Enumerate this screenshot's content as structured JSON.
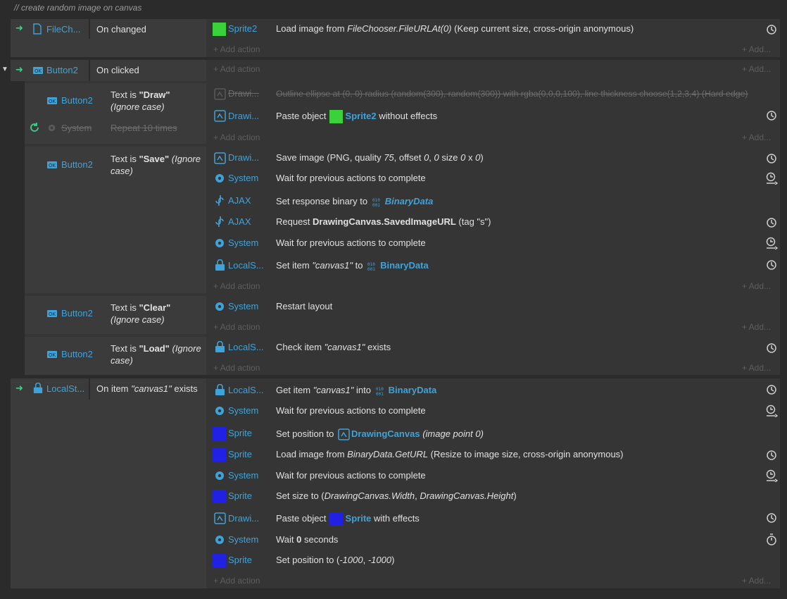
{
  "comment": "//  create random image on canvas",
  "add_action": "+ Add action",
  "add_more": "+ Add...",
  "events": [
    {
      "cond": {
        "obj": "FileCh...",
        "text": "On changed"
      },
      "actions": [
        {
          "obj": "Sprite2",
          "text": "Load image from FileChooser.FileURLAt(0) (Keep current size, cross-origin anonymous)"
        }
      ]
    },
    {
      "cond": {
        "obj": "Button2",
        "text": "On clicked"
      }
    },
    {
      "sub1": {
        "obj": "Button2",
        "text_pre": "Text is ",
        "text_val": "\"Draw\"",
        "text_post": "(Ignore case)",
        "sys": "System",
        "repeat": "Repeat 10 times",
        "actions": [
          {
            "obj": "Drawi...",
            "text": "Outline ellipse at (0, 0) radius (random(300), random(300)) with rgba(0,0,0,100), line thickness choose(1,2,3,4) (Hard edge)"
          },
          {
            "obj": "Drawi...",
            "pre": "Paste object",
            "target": "Sprite2",
            "post": "without effects"
          }
        ]
      }
    },
    {
      "sub2": {
        "obj": "Button2",
        "text_pre": "Text is ",
        "text_val": "\"Save\"",
        "text_post": "(Ignore case)",
        "actions": [
          {
            "obj": "Drawi...",
            "text": "Save image (PNG, quality 75, offset 0, 0 size 0 x 0)"
          },
          {
            "obj": "System",
            "text": "Wait for previous actions to complete"
          },
          {
            "obj": "AJAX",
            "pre": "Set response binary to",
            "target": "BinaryData"
          },
          {
            "obj": "AJAX",
            "pre": "Request",
            "bold": "DrawingCanvas.SavedImageURL",
            "post": "(tag \"s\")"
          },
          {
            "obj": "System",
            "text": "Wait for previous actions to complete"
          },
          {
            "obj": "LocalS...",
            "pre": "Set item",
            "item": "\"canvas1\"",
            "mid": "to",
            "target": "BinaryData"
          }
        ]
      }
    },
    {
      "sub3": {
        "obj": "Button2",
        "text_pre": "Text is ",
        "text_val": "\"Clear\"",
        "text_post": "(Ignore case)",
        "actions": [
          {
            "obj": "System",
            "text": "Restart layout"
          }
        ]
      }
    },
    {
      "sub4": {
        "obj": "Button2",
        "text_pre": "Text is ",
        "text_val": "\"Load\"",
        "text_post": "(Ignore case)",
        "actions": [
          {
            "obj": "LocalS...",
            "pre": "Check item",
            "item": "\"canvas1\"",
            "post": "exists"
          }
        ]
      }
    },
    {
      "ev3": {
        "obj": "LocalSt...",
        "text_pre": "On item ",
        "item": "\"canvas1\"",
        "text_post": " exists",
        "actions": [
          {
            "obj": "LocalS...",
            "pre": "Get item",
            "item": "\"canvas1\"",
            "mid": "into",
            "target": "BinaryData"
          },
          {
            "obj": "System",
            "text": "Wait for previous actions to complete"
          },
          {
            "obj": "Sprite",
            "pre": "Set position to",
            "target": "DrawingCanvas",
            "post": "(image point 0)"
          },
          {
            "obj": "Sprite",
            "text": "Load image from BinaryData.GetURL (Resize to image size, cross-origin anonymous)"
          },
          {
            "obj": "System",
            "text": "Wait for previous actions to complete"
          },
          {
            "obj": "Sprite",
            "text": "Set size to (DrawingCanvas.Width, DrawingCanvas.Height)"
          },
          {
            "obj": "Drawi...",
            "pre": "Paste object",
            "target": "Sprite",
            "post": "with effects"
          },
          {
            "obj": "System",
            "pre": "Wait",
            "bold": "0",
            "post": "seconds"
          },
          {
            "obj": "Sprite",
            "text": "Set position to (-1000, -1000)"
          }
        ]
      }
    }
  ],
  "colors": {
    "accent": "#3fa3d9",
    "trigger": "#3bd18a",
    "sprite2": "#3bd13b",
    "sprite": "#2121e6",
    "bg": "#2b2b2b"
  }
}
